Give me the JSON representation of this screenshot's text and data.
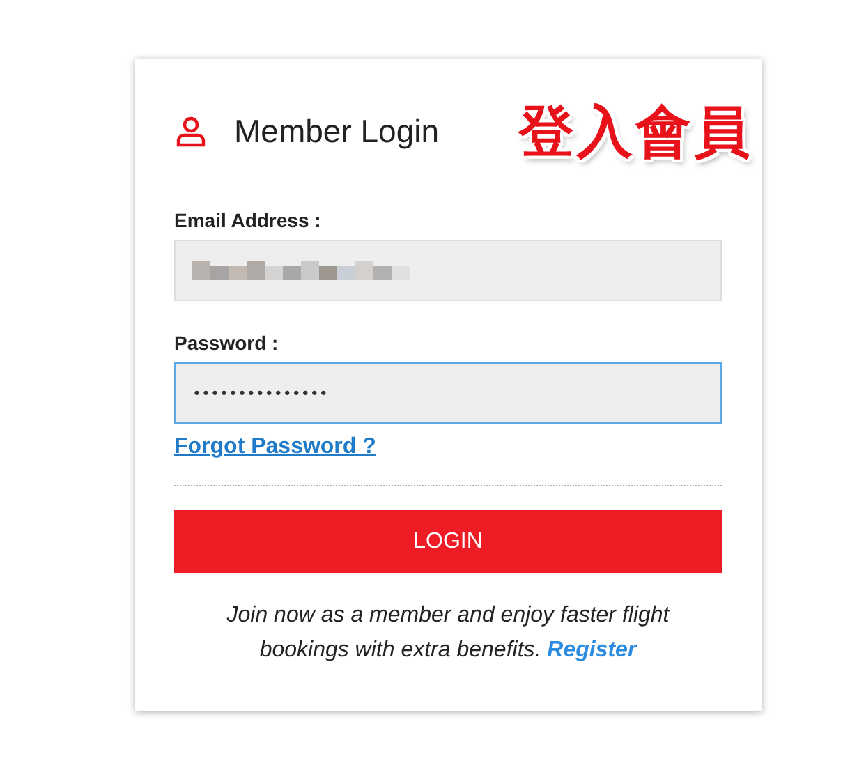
{
  "card": {
    "title": "Member Login",
    "annotation": "登入會員"
  },
  "fields": [
    {
      "kind": "email",
      "label": "Email Address :",
      "redacted": true,
      "focused": false
    },
    {
      "kind": "password",
      "label": "Password :",
      "value": "•••••••••••••••",
      "focused": true
    }
  ],
  "forgot_link": "Forgot Password ?",
  "login_button": "LOGIN",
  "footer": {
    "text": "Join now as a member and enjoy faster flight bookings with extra benefits.",
    "link": "Register"
  }
}
